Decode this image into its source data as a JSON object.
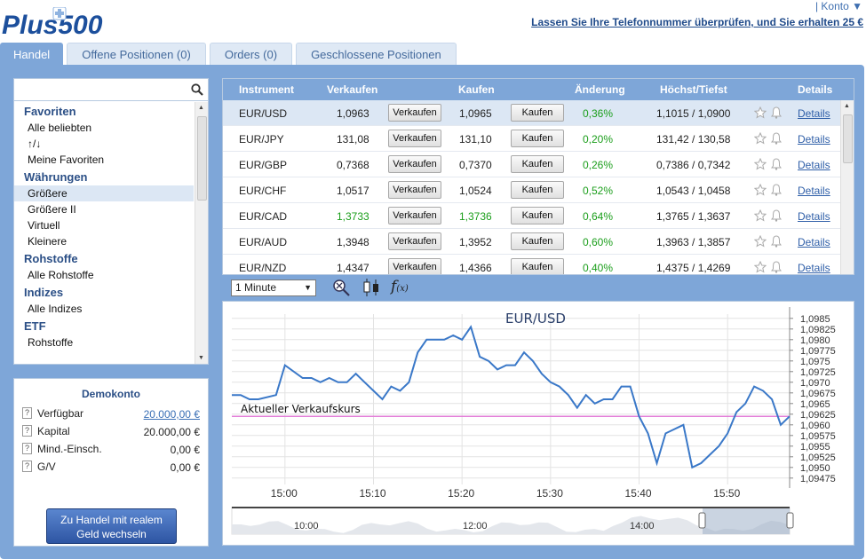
{
  "brand": {
    "logo_text": "Plus500",
    "konto_label": "Konto"
  },
  "promo": {
    "text": "Lassen Sie Ihre Telefonnummer überprüfen, und Sie erhalten 25 €"
  },
  "tabs": [
    {
      "label": "Handel",
      "active": true
    },
    {
      "label": "Offene Positionen (0)",
      "active": false
    },
    {
      "label": "Orders (0)",
      "active": false
    },
    {
      "label": "Geschlossene Positionen",
      "active": false
    }
  ],
  "search": {
    "placeholder": ""
  },
  "categories": {
    "favoriten": {
      "title": "Favoriten",
      "items": [
        "Alle beliebten",
        "↑/↓",
        "Meine Favoriten"
      ]
    },
    "waehrungen": {
      "title": "Währungen",
      "items": [
        "Größere",
        "Größere II",
        "Virtuell",
        "Kleinere"
      ]
    },
    "rohstoffe": {
      "title": "Rohstoffe",
      "items": [
        "Alle Rohstoffe"
      ]
    },
    "indizes": {
      "title": "Indizes",
      "items": [
        "Alle Indizes"
      ]
    },
    "etf": {
      "title": "ETF",
      "items": [
        "Rohstoffe"
      ]
    }
  },
  "demo": {
    "title": "Demokonto",
    "rows": [
      {
        "label": "Verfügbar",
        "value": "20.000,00 €"
      },
      {
        "label": "Kapital",
        "value": "20.000,00 €"
      },
      {
        "label": "Mind.-Einsch.",
        "value": "0,00 €"
      },
      {
        "label": "G/V",
        "value": "0,00 €"
      }
    ],
    "real_button_line1": "Zu Handel mit realem",
    "real_button_line2": "Geld wechseln"
  },
  "table": {
    "headers": {
      "instrument": "Instrument",
      "sell": "Verkaufen",
      "buy": "Kaufen",
      "change": "Änderung",
      "highlow": "Höchst/Tiefst",
      "details": "Details"
    },
    "sell_button": "Verkaufen",
    "buy_button": "Kaufen",
    "details_link": "Details",
    "rows": [
      {
        "instrument": "EUR/USD",
        "sell": "1,0963",
        "buy": "1,0965",
        "change": "0,36%",
        "highlow": "1,1015 / 1,0900"
      },
      {
        "instrument": "EUR/JPY",
        "sell": "131,08",
        "buy": "131,10",
        "change": "0,20%",
        "highlow": "131,42 / 130,58"
      },
      {
        "instrument": "EUR/GBP",
        "sell": "0,7368",
        "buy": "0,7370",
        "change": "0,26%",
        "highlow": "0,7386 / 0,7342"
      },
      {
        "instrument": "EUR/CHF",
        "sell": "1,0517",
        "buy": "1,0524",
        "change": "0,52%",
        "highlow": "1,0543 / 1,0458"
      },
      {
        "instrument": "EUR/CAD",
        "sell": "1,3733",
        "buy": "1,3736",
        "change": "0,64%",
        "highlow": "1,3765 / 1,3637"
      },
      {
        "instrument": "EUR/AUD",
        "sell": "1,3948",
        "buy": "1,3952",
        "change": "0,60%",
        "highlow": "1,3963 / 1,3857"
      },
      {
        "instrument": "EUR/NZD",
        "sell": "1,4347",
        "buy": "1,4366",
        "change": "0,40%",
        "highlow": "1,4375 / 1,4269"
      }
    ]
  },
  "toolbar": {
    "interval": "1 Minute"
  },
  "colors": {
    "accent": "#7ea6d8",
    "line": "#3a78c8",
    "current_line": "#e37fd8",
    "gain": "#1b9e1b"
  },
  "chart_data": {
    "type": "line",
    "title": "EUR/USD",
    "current_label": "Aktueller Verkaufskurs",
    "current_value": 1.0962,
    "ylim": [
      1.0946,
      1.0986
    ],
    "y_ticks": [
      1.0985,
      1.09825,
      1.098,
      1.09775,
      1.0975,
      1.09725,
      1.097,
      1.09675,
      1.0965,
      1.09625,
      1.096,
      1.09575,
      1.0955,
      1.09525,
      1.095,
      1.09475
    ],
    "y_tick_labels": [
      "1,0985",
      "1,09825",
      "1,0980",
      "1,09775",
      "1,0975",
      "1,09725",
      "1,0970",
      "1,09675",
      "1,0965",
      "1,09625",
      "1,0960",
      "1,09575",
      "1,0955",
      "1,09525",
      "1,0950",
      "1,09475"
    ],
    "x_min": 894,
    "x_max": 957,
    "x_ticks": [
      900,
      910,
      920,
      930,
      940,
      950
    ],
    "x_tick_labels": [
      "15:00",
      "15:10",
      "15:20",
      "15:30",
      "15:40",
      "15:50"
    ],
    "x": [
      894,
      895,
      896,
      897,
      899,
      900,
      902,
      903,
      904,
      905,
      906,
      907,
      908,
      909,
      910,
      911,
      912,
      913,
      914,
      915,
      916,
      917,
      918,
      919,
      920,
      921,
      922,
      923,
      924,
      925,
      926,
      927,
      928,
      929,
      930,
      931,
      932,
      933,
      934,
      935,
      936,
      937,
      938,
      939,
      940,
      941,
      942,
      943,
      944,
      945,
      946,
      947,
      948,
      949,
      950,
      951,
      952,
      953,
      954,
      955,
      956,
      957
    ],
    "y": [
      1.0967,
      1.0967,
      1.0966,
      1.0966,
      1.0967,
      1.0974,
      1.0971,
      1.0971,
      1.097,
      1.0971,
      1.097,
      1.097,
      1.0972,
      1.097,
      1.0968,
      1.0966,
      1.0969,
      1.0968,
      1.097,
      1.0977,
      1.098,
      1.098,
      1.098,
      1.0981,
      1.098,
      1.0983,
      1.0976,
      1.0975,
      1.0973,
      1.0974,
      1.0974,
      1.0977,
      1.0975,
      1.0972,
      1.097,
      1.0969,
      1.0967,
      1.0964,
      1.0967,
      1.0965,
      1.0966,
      1.0966,
      1.0969,
      1.0969,
      1.0962,
      1.0958,
      1.0951,
      1.0958,
      1.0959,
      1.096,
      1.095,
      1.0951,
      1.0953,
      1.0955,
      1.0958,
      1.0963,
      1.0965,
      1.0969,
      1.0968,
      1.0966,
      1.096,
      1.0962
    ],
    "navigator": {
      "x_tick_labels": [
        "10:00",
        "12:00",
        "14:00"
      ]
    },
    "grid": true
  }
}
